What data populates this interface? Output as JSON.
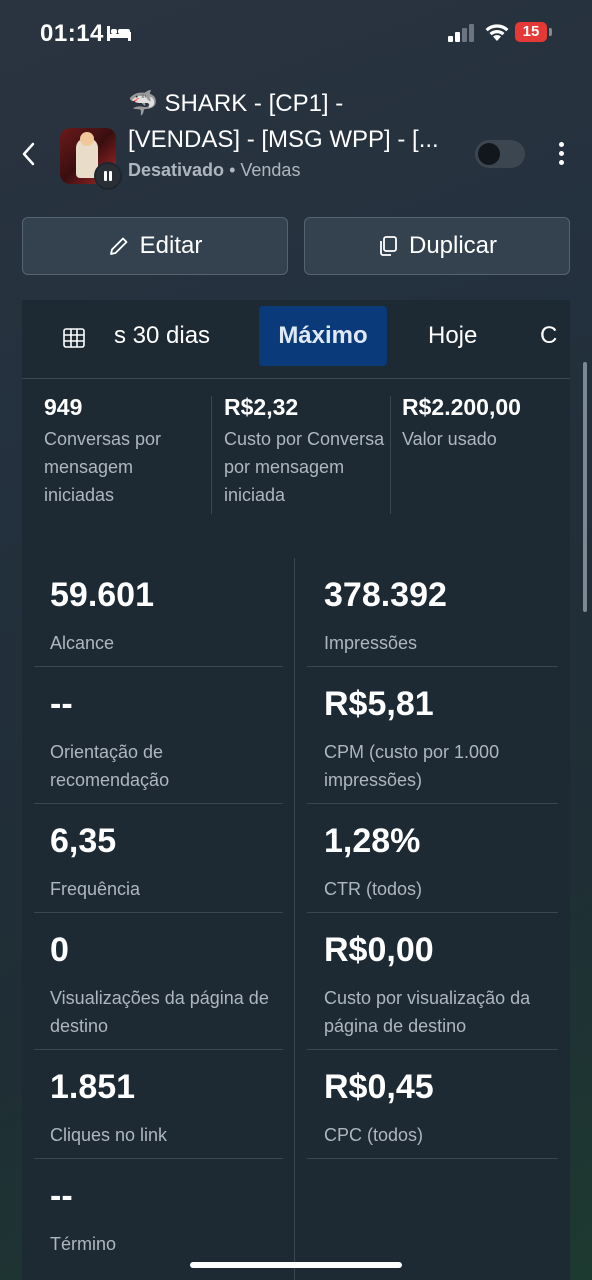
{
  "status": {
    "time": "01:14",
    "battery": "15"
  },
  "header": {
    "title_line1": "🦈 SHARK - [CP1] -",
    "title_line2": "[VENDAS] - [MSG WPP] - [...",
    "status_label": "Desativado",
    "separator": "•",
    "objective": "Vendas"
  },
  "actions": {
    "edit_label": "Editar",
    "duplicate_label": "Duplicar"
  },
  "tabs": {
    "last30": "s 30 dias",
    "max": "Máximo",
    "today": "Hoje",
    "next": "C"
  },
  "summary": [
    {
      "value": "949",
      "label": "Conversas por mensagem iniciadas"
    },
    {
      "value": "R$2,32",
      "label": "Custo por Conversa por mensagem iniciada"
    },
    {
      "value": "R$2.200,00",
      "label": "Valor usado"
    }
  ],
  "metrics_left": [
    {
      "value": "59.601",
      "label": "Alcance"
    },
    {
      "value": "--",
      "label": "Orientação de recomendação"
    },
    {
      "value": "6,35",
      "label": "Frequência"
    },
    {
      "value": "0",
      "label": "Visualizações da página de destino"
    },
    {
      "value": "1.851",
      "label": "Cliques no link"
    },
    {
      "value": "--",
      "label": "Término"
    }
  ],
  "metrics_right": [
    {
      "value": "378.392",
      "label": "Impressões"
    },
    {
      "value": "R$5,81",
      "label": "CPM (custo por 1.000 impressões)"
    },
    {
      "value": "1,28%",
      "label": "CTR (todos)"
    },
    {
      "value": "R$0,00",
      "label": "Custo por visualização da página de destino"
    },
    {
      "value": "R$0,45",
      "label": "CPC (todos)"
    }
  ]
}
